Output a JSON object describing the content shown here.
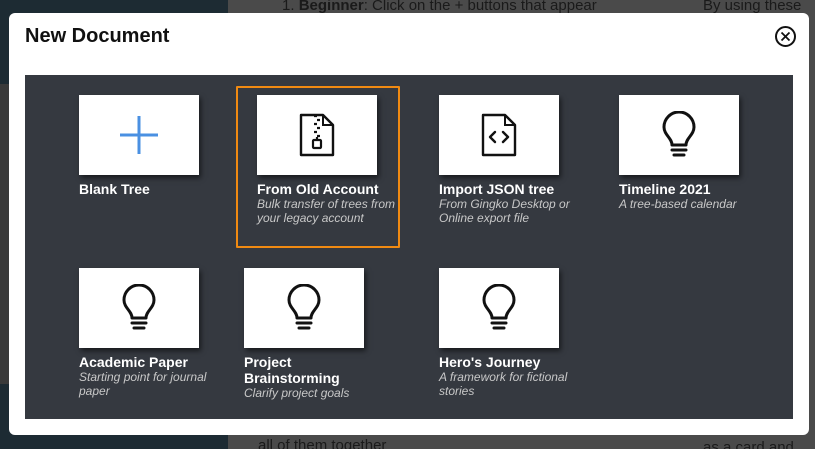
{
  "background": {
    "line1_number": "1.",
    "line1_bold": "Beginner",
    "line1_rest": ": Click on the  +  buttons that appear",
    "right_top": "By using these",
    "bottom_left": "all of them together",
    "bottom_right": "as a card and"
  },
  "modal": {
    "title": "New Document",
    "close_label": "close"
  },
  "templates": [
    {
      "title": "Blank Tree",
      "desc": "",
      "icon": "plus-icon",
      "selected": false
    },
    {
      "title": "From Old Account",
      "desc": "Bulk transfer of trees from your legacy account",
      "icon": "zip-file-icon",
      "selected": true
    },
    {
      "title": "Import JSON tree",
      "desc": "From Gingko Desktop or Online export file",
      "icon": "code-file-icon",
      "selected": false
    },
    {
      "title": "Timeline 2021",
      "desc": "A tree-based calendar",
      "icon": "lightbulb-icon",
      "selected": false
    },
    {
      "title": "Academic Paper",
      "desc": "Starting point for journal paper",
      "icon": "lightbulb-icon",
      "selected": false
    },
    {
      "title": "Project Brainstorming",
      "desc": "Clarify project goals",
      "icon": "lightbulb-icon",
      "selected": false
    },
    {
      "title": "Hero's Journey",
      "desc": "A framework for fictional stories",
      "icon": "lightbulb-icon",
      "selected": false
    }
  ],
  "colors": {
    "accent": "#f08a12",
    "plus": "#4a90e2",
    "panel": "#353940"
  }
}
